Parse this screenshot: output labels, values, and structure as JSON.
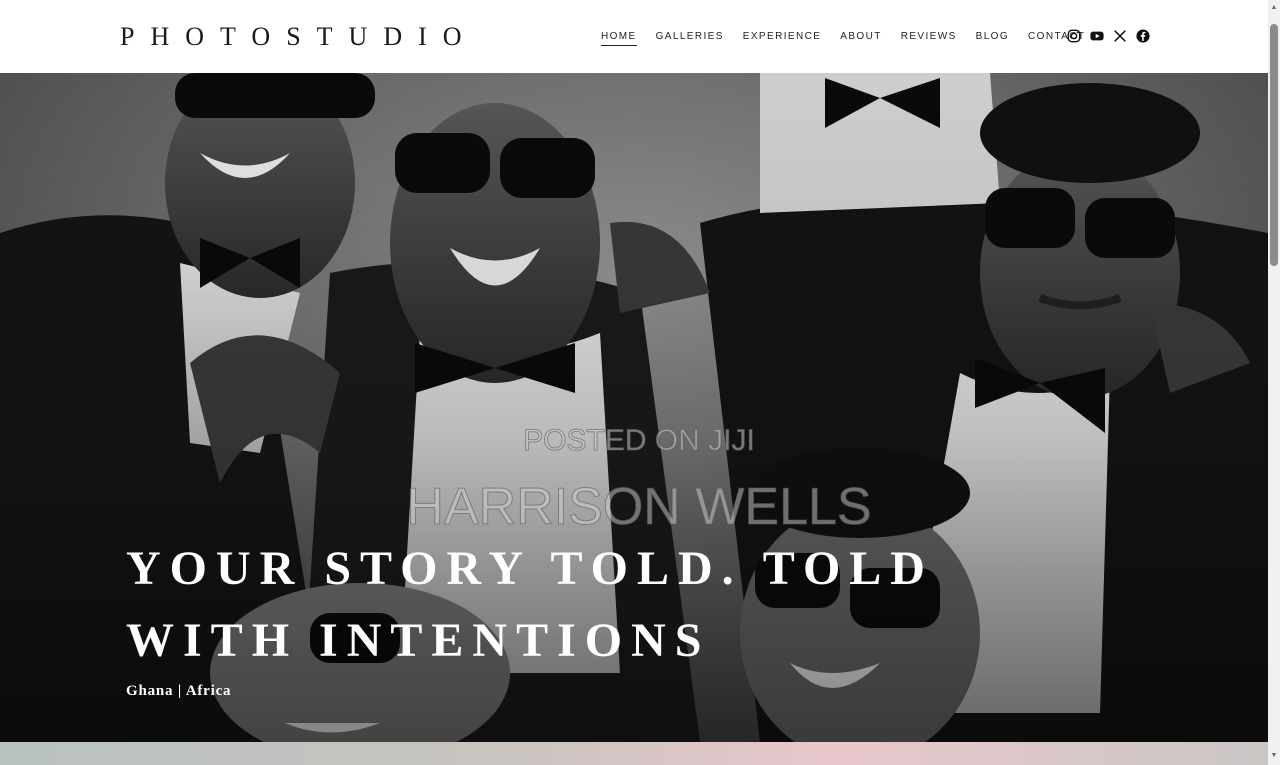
{
  "header": {
    "logo": "PHOTOSTUDIO",
    "nav": [
      {
        "label": "HOME",
        "active": true
      },
      {
        "label": "GALLERIES"
      },
      {
        "label": "EXPERIENCE"
      },
      {
        "label": "ABOUT"
      },
      {
        "label": "REVIEWS"
      },
      {
        "label": "BLOG"
      },
      {
        "label": "CONTACT"
      }
    ],
    "social_icons": [
      "instagram-icon",
      "youtube-icon",
      "x-icon",
      "facebook-icon"
    ]
  },
  "hero": {
    "watermark_line1": "POSTED ON JIJI",
    "watermark_line2": "HARRISON WELLS",
    "headline": "YOUR STORY TOLD. TOLD WITH INTENTIONS",
    "location": "Ghana | Africa",
    "photo_description_tone": "black-and-white group of men in tuxedos and sunglasses"
  },
  "colors": {
    "text_dark": "#1a1a1a",
    "hero_text": "#ffffff"
  }
}
